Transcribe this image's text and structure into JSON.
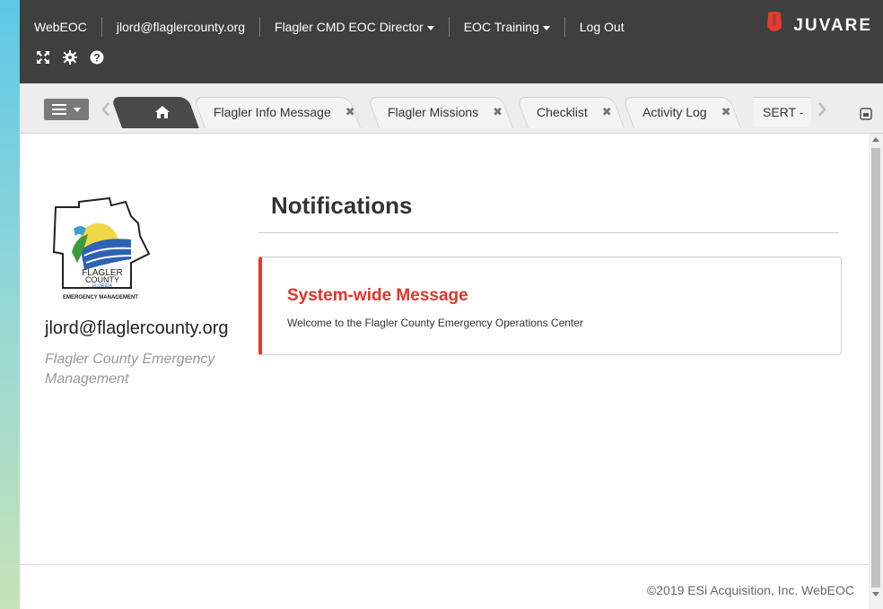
{
  "topbar": {
    "nav": [
      {
        "name": "nav-webeoc",
        "label": "WebEOC",
        "dropdown": false
      },
      {
        "name": "nav-user-email",
        "label": "jlord@flaglercounty.org",
        "dropdown": false
      },
      {
        "name": "nav-position",
        "label": "Flagler CMD EOC Director",
        "dropdown": true
      },
      {
        "name": "nav-incident",
        "label": "EOC Training",
        "dropdown": true
      },
      {
        "name": "nav-logout",
        "label": "Log Out",
        "dropdown": false
      }
    ],
    "icons": [
      "fullscreen-icon",
      "gear-icon",
      "help-icon"
    ],
    "brand": "JUVARE",
    "colors": {
      "bar": "#3f3f3f",
      "brand_red": "#e53a2f"
    }
  },
  "tabs": [
    {
      "label": "",
      "icon": "home-icon",
      "active": true
    },
    {
      "label": "Flagler Info Message",
      "closable": true
    },
    {
      "label": "Flagler Missions",
      "closable": true
    },
    {
      "label": "Checklist",
      "closable": true
    },
    {
      "label": "Activity Log",
      "closable": true
    },
    {
      "label": "SERT -",
      "closable": false
    }
  ],
  "tab_close_glyph": "✖",
  "sidebar": {
    "logo": {
      "text_lines": [
        "FLAGLER",
        "COUNTY",
        "FLORIDA"
      ],
      "caption": "EMERGENCY MANAGEMENT"
    },
    "user_email": "jlord@flaglercounty.org",
    "org_name": "Flagler County Emergency Management"
  },
  "main": {
    "heading": "Notifications",
    "notification": {
      "title": "System-wide Message",
      "body": "Welcome to the Flagler County Emergency Operations Center",
      "accent": "#e53a2f"
    }
  },
  "footer": {
    "copyright": "©2019 ESi Acquisition, Inc. WebEOC"
  }
}
